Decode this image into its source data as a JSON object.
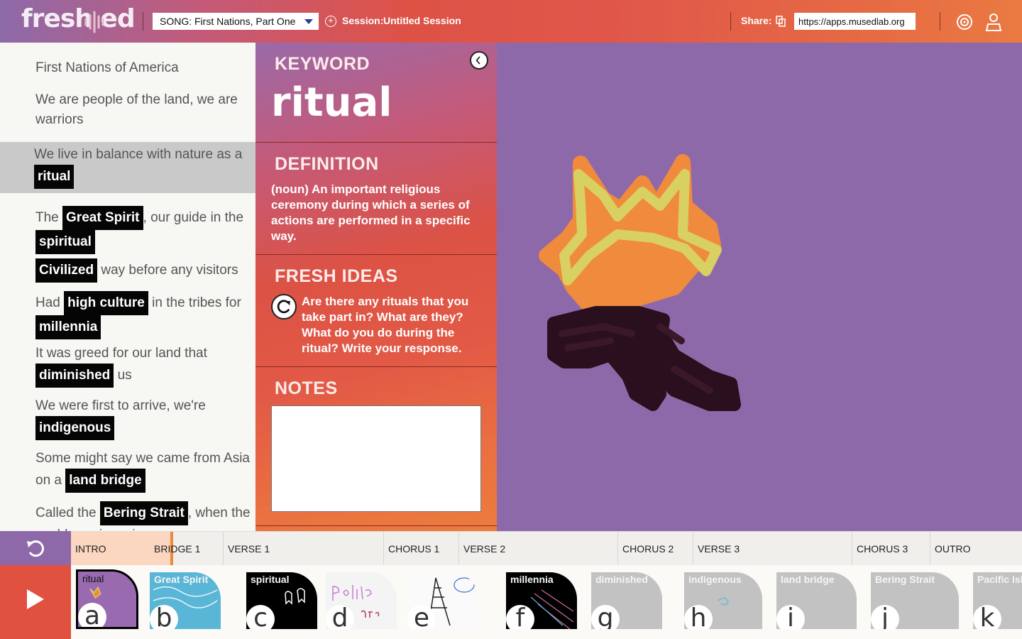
{
  "header": {
    "logo": "fresh ed",
    "song_select": "SONG: First Nations, Part One",
    "session_label": "Session:",
    "session_name": "Untitled Session",
    "share_label": "Share:",
    "share_url": "https://apps.musedlab.org"
  },
  "lyrics": [
    {
      "pre": "First Nations of America",
      "kw": "",
      "post": ""
    },
    {
      "pre": "We are people of the land, we are warriors",
      "kw": "",
      "post": ""
    },
    {
      "pre": "We live in balance with nature as a ",
      "kw": "ritual",
      "post": ""
    },
    {
      "pre": "The ",
      "kw": "Great Spirit",
      "mid": ", our guide in the ",
      "kw2": "spiritual",
      "post": ""
    },
    {
      "pre": "",
      "kw": "Civilized",
      "post": " way before any visitors"
    },
    {
      "pre": "Had ",
      "kw": "high culture",
      "mid": " in the tribes for ",
      "kw2": "millennia",
      "post": ""
    },
    {
      "pre": "It was greed for our land that ",
      "kw": "diminished",
      "post": " us"
    },
    {
      "pre": "We were first to arrive, we're ",
      "kw": "indigenous",
      "post": ""
    },
    {
      "pre": "Some might say we came from Asia on a ",
      "kw": "land bridge",
      "post": ""
    },
    {
      "pre": "Called the ",
      "kw": "Bering Strait",
      "post": ", when the world was in an ice age"
    }
  ],
  "keyword_panel": {
    "keyword_title": "KEYWORD",
    "keyword": "ritual",
    "definition_title": "DEFINITION",
    "definition": "(noun) An important religious ceremony during which a series of actions are performed in a specific way.",
    "ideas_title": "FRESH IDEAS",
    "ideas": "Are there any rituals that you take part in? What are they? What do you do during the ritual? Write your response.",
    "notes_title": "NOTES",
    "notes_value": ""
  },
  "timeline": {
    "progress_percent": 10.6,
    "segments": [
      "INTRO",
      "BRIDGE 1",
      "VERSE 1",
      "CHORUS 1",
      "VERSE 2",
      "CHORUS 2",
      "VERSE 3",
      "CHORUS 3",
      "OUTRO"
    ]
  },
  "cards": [
    {
      "label": "ritual",
      "letter": "a",
      "color": "#9a6ab0"
    },
    {
      "label": "Great Spirit",
      "letter": "b",
      "color": "#5ab6d6"
    },
    {
      "label": "spiritual",
      "letter": "c",
      "color": "#000000"
    },
    {
      "label": "",
      "letter": "d",
      "color": "#f4f4f4"
    },
    {
      "label": "",
      "letter": "e",
      "color": "#fafafa"
    },
    {
      "label": "millennia",
      "letter": "f",
      "color": "#000000"
    },
    {
      "label": "diminished",
      "letter": "g",
      "color": "#c2c2c2"
    },
    {
      "label": "indigenous",
      "letter": "h",
      "color": "#c2c2c2"
    },
    {
      "label": "land bridge",
      "letter": "i",
      "color": "#c2c2c2"
    },
    {
      "label": "Bering Strait",
      "letter": "j",
      "color": "#c2c2c2"
    },
    {
      "label": "Pacific Isl",
      "letter": "k",
      "color": "#c2c2c2"
    }
  ],
  "drawing_colors": {
    "background": "#8e69a9",
    "orange": "#f08a3c",
    "yellow": "#d8d060",
    "dark": "#2a0f1e"
  }
}
